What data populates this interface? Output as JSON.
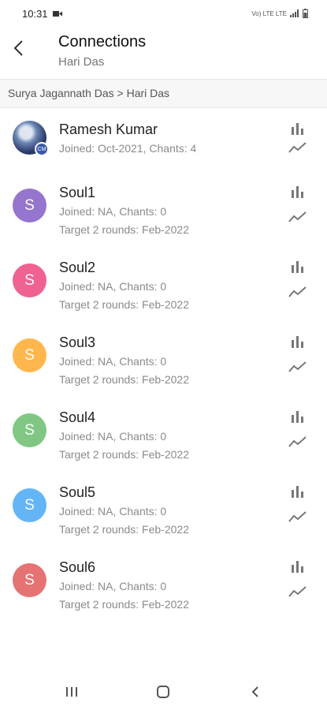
{
  "status_bar": {
    "time": "10:31",
    "indicators": "Vo) LTE LTE"
  },
  "header": {
    "title": "Connections",
    "subtitle": "Hari Das"
  },
  "breadcrumb": "Surya Jagannath Das > Hari Das",
  "connections": [
    {
      "name": "Ramesh Kumar",
      "line1": "Joined: Oct-2021, Chants: 4",
      "line2": "",
      "avatar_type": "photo",
      "badge": "CM"
    },
    {
      "name": "Soul1",
      "line1": "Joined: NA, Chants: 0",
      "line2": "Target 2 rounds: Feb-2022",
      "initial": "S",
      "color": "#9575cd"
    },
    {
      "name": "Soul2",
      "line1": "Joined: NA, Chants: 0",
      "line2": "Target 2 rounds: Feb-2022",
      "initial": "S",
      "color": "#f06292"
    },
    {
      "name": "Soul3",
      "line1": "Joined: NA, Chants: 0",
      "line2": "Target 2 rounds: Feb-2022",
      "initial": "S",
      "color": "#ffb74d"
    },
    {
      "name": "Soul4",
      "line1": "Joined: NA, Chants: 0",
      "line2": "Target 2 rounds: Feb-2022",
      "initial": "S",
      "color": "#81c784"
    },
    {
      "name": "Soul5",
      "line1": "Joined: NA, Chants: 0",
      "line2": "Target 2 rounds: Feb-2022",
      "initial": "S",
      "color": "#64b5f6"
    },
    {
      "name": "Soul6",
      "line1": "Joined: NA, Chants: 0",
      "line2": "Target 2 rounds: Feb-2022",
      "initial": "S",
      "color": "#e57373"
    }
  ],
  "icons": {
    "back": "back-arrow-icon",
    "stats": "bar-chart-icon",
    "trend": "trend-line-icon"
  }
}
